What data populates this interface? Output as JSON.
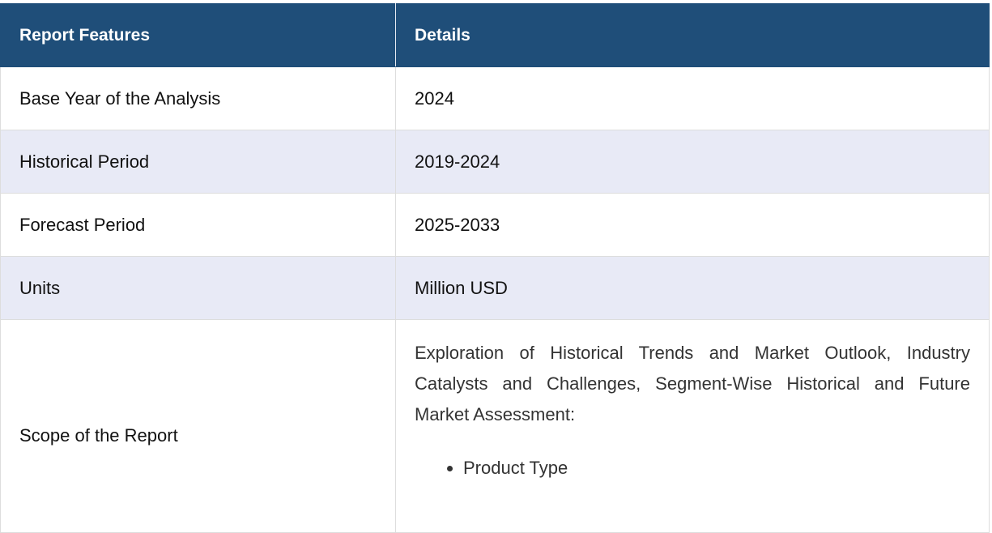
{
  "table": {
    "headers": [
      "Report Features",
      "Details"
    ],
    "rows": [
      {
        "feature": "Base Year of the Analysis",
        "detail": "2024"
      },
      {
        "feature": "Historical Period",
        "detail": "2019-2024"
      },
      {
        "feature": "Forecast Period",
        "detail": "2025-2033"
      },
      {
        "feature": "Units",
        "detail": "Million USD"
      }
    ],
    "scope": {
      "feature": "Scope of the Report",
      "text": "Exploration of Historical Trends and Market Outlook, Industry Catalysts and Challenges, Segment-Wise Historical and Future Market Assessment:",
      "items": [
        "Product Type"
      ]
    }
  },
  "colors": {
    "header_bg": "#1f4e79",
    "alt_row_bg": "#e8eaf6"
  }
}
